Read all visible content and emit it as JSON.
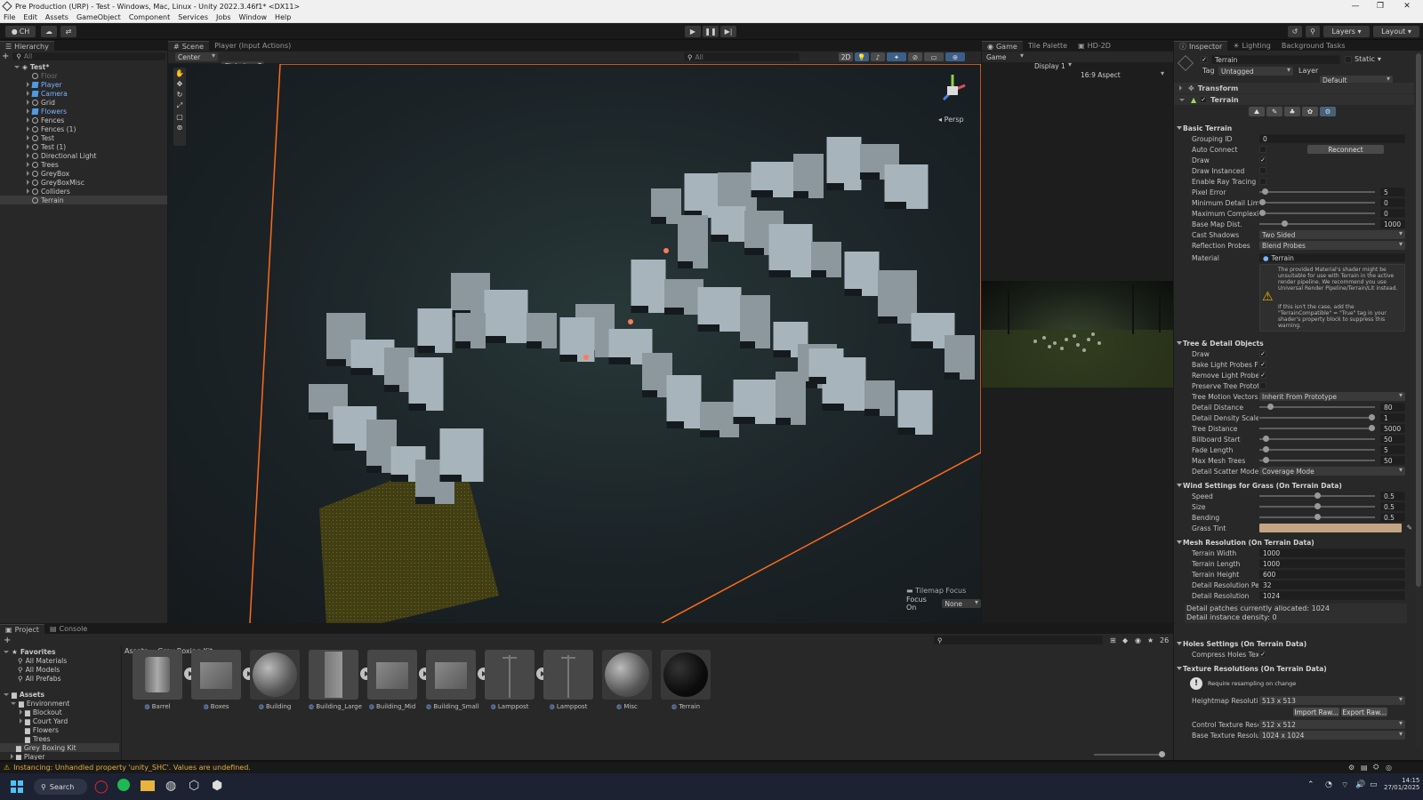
{
  "window": {
    "title": "Pre Production (URP) - Test - Windows, Mac, Linux - Unity 2022.3.46f1* <DX11>",
    "menu": [
      "File",
      "Edit",
      "Assets",
      "GameObject",
      "Component",
      "Services",
      "Jobs",
      "Window",
      "Help"
    ]
  },
  "toolbar": {
    "account": "CH",
    "layers": "Layers",
    "layout": "Layout"
  },
  "hierarchy": {
    "tab": "Hierarchy",
    "search_placeholder": "All",
    "scene": "Test*",
    "items": [
      {
        "name": "Floor",
        "style": "dim"
      },
      {
        "name": "Player",
        "style": "blue"
      },
      {
        "name": "Camera",
        "style": "blue"
      },
      {
        "name": "Grid",
        "style": ""
      },
      {
        "name": "Flowers",
        "style": "blue"
      },
      {
        "name": "Fences",
        "style": ""
      },
      {
        "name": "Fences (1)",
        "style": ""
      },
      {
        "name": "Test",
        "style": ""
      },
      {
        "name": "Test (1)",
        "style": ""
      },
      {
        "name": "Directional Light",
        "style": ""
      },
      {
        "name": "Trees",
        "style": ""
      },
      {
        "name": "GreyBox",
        "style": ""
      },
      {
        "name": "GreyBoxMisc",
        "style": ""
      },
      {
        "name": "Colliders",
        "style": ""
      },
      {
        "name": "Terrain",
        "style": "sel"
      }
    ]
  },
  "scene": {
    "tab_scene": "Scene",
    "tab_player": "Player (Input Actions)",
    "pivot": "Center",
    "space": "Global",
    "mode_2d": "2D",
    "search_placeholder": "All",
    "persp": "Persp",
    "tilemap_focus": "Tilemap Focus",
    "focus_on": "Focus On",
    "focus_value": "None"
  },
  "game": {
    "tab_game": "Game",
    "tab_tile": "Tile Palette",
    "tab_hd": "HD-2D",
    "mode": "Game",
    "display": "Display 1",
    "aspect": "16:9 Aspect"
  },
  "inspector": {
    "tab_inspector": "Inspector",
    "tab_lighting": "Lighting",
    "tab_bg": "Background Tasks",
    "object_name": "Terrain",
    "static": "Static",
    "tag_label": "Tag",
    "tag": "Untagged",
    "layer_label": "Layer",
    "layer": "Default",
    "comp_transform": "Transform",
    "comp_terrain": "Terrain",
    "basic_title": "Basic Terrain",
    "grouping_id_label": "Grouping ID",
    "grouping_id": "0",
    "auto_connect_label": "Auto Connect",
    "reconnect": "Reconnect",
    "draw_label": "Draw",
    "draw_instanced_label": "Draw Instanced",
    "ray_tracing_label": "Enable Ray Tracing S",
    "pixel_error_label": "Pixel Error",
    "pixel_error": "5",
    "pixel_error_frac": 0.025,
    "min_detail_label": "Minimum Detail Limit",
    "min_detail": "0",
    "max_complexity_label": "Maximum Complexity",
    "max_complexity": "0",
    "basemap_label": "Base Map Dist.",
    "basemap": "1000",
    "basemap_frac": 0.2,
    "cast_shadows_label": "Cast Shadows",
    "cast_shadows": "Two Sided",
    "reflection_label": "Reflection Probes",
    "reflection": "Blend Probes",
    "material_label": "Material",
    "material": "Terrain",
    "warning1": "The provided Material's shader might be unsuitable for use with Terrain in the active render pipeline. We recommend you use Universal Render Pipeline/Terrain/Lit instead.",
    "warning2": "If this isn't the case, add the \"TerrainCompatible\" = \"True\" tag in your shader's property block to suppress this warning.",
    "tree_title": "Tree & Detail Objects",
    "tree_draw_label": "Draw",
    "bake_label": "Bake Light Probes For",
    "remove_label": "Remove Light Probe R",
    "preserve_label": "Preserve Tree Prototy",
    "motion_label": "Tree Motion Vectors",
    "motion": "Inherit From Prototype",
    "detail_dist_label": "Detail Distance",
    "detail_dist": "80",
    "detail_dist_frac": 0.07,
    "density_label": "Detail Density Scale",
    "density": "1",
    "density_frac": 1.0,
    "tree_dist_label": "Tree Distance",
    "tree_dist": "5000",
    "tree_dist_frac": 1.0,
    "billboard_label": "Billboard Start",
    "billboard": "50",
    "billboard_frac": 0.03,
    "fade_label": "Fade Length",
    "fade": "5",
    "fade_frac": 0.03,
    "mesh_trees_label": "Max Mesh Trees",
    "mesh_trees": "50",
    "mesh_trees_frac": 0.03,
    "scatter_label": "Detail Scatter Mode",
    "scatter": "Coverage Mode",
    "wind_title": "Wind Settings for Grass (On Terrain Data)",
    "speed_label": "Speed",
    "speed": "0.5",
    "speed_frac": 0.5,
    "size_label": "Size",
    "size": "0.5",
    "size_frac": 0.5,
    "bending_label": "Bending",
    "bending": "0.5",
    "bending_frac": 0.5,
    "tint_label": "Grass Tint",
    "tint_color": "#c4a582",
    "mesh_title": "Mesh Resolution (On Terrain Data)",
    "width_label": "Terrain Width",
    "width": "1000",
    "length_label": "Terrain Length",
    "length": "1000",
    "height_label": "Terrain Height",
    "height": "600",
    "detail_per_label": "Detail Resolution Per",
    "detail_per": "32",
    "detail_res_label": "Detail Resolution",
    "detail_res": "1024",
    "patches": "Detail patches currently allocated: 1024",
    "instance_density": "Detail instance density: 0",
    "holes_title": "Holes Settings (On Terrain Data)",
    "compress_label": "Compress Holes Textu",
    "texres_title": "Texture Resolutions (On Terrain Data)",
    "resample": "Require resampling on change",
    "heightmap_label": "Heightmap Resolution",
    "heightmap": "513 x 513",
    "import_raw": "Import Raw...",
    "export_raw": "Export Raw...",
    "control_label": "Control Texture Resol",
    "control": "512 x 512",
    "base_tex_label": "Base Texture Resoluti",
    "base_tex": "1024 x 1024"
  },
  "project": {
    "tab_project": "Project",
    "tab_console": "Console",
    "favorites": "Favorites",
    "fav_items": [
      "All Materials",
      "All Models",
      "All Prefabs"
    ],
    "assets": "Assets",
    "environment": "Environment",
    "env_items": [
      "Blockout",
      "Court Yard",
      "Flowers",
      "Trees"
    ],
    "grey_kit": "Grey Boxing Kit",
    "player": "Player",
    "breadcrumb_root": "Assets",
    "breadcrumb_leaf": "Grey Boxing Kit",
    "count": "26",
    "assets_list": [
      "Barrel",
      "Boxes",
      "Building",
      "Building_Large",
      "Building_Mid",
      "Building_Small",
      "Lamppost",
      "Lamppost",
      "Misc",
      "Terrain"
    ]
  },
  "status": {
    "message": "Instancing: Unhandled property 'unity_SHC'. Values are undefined."
  },
  "taskbar": {
    "search": "Search",
    "time": "14:15",
    "date": "27/01/2025"
  }
}
